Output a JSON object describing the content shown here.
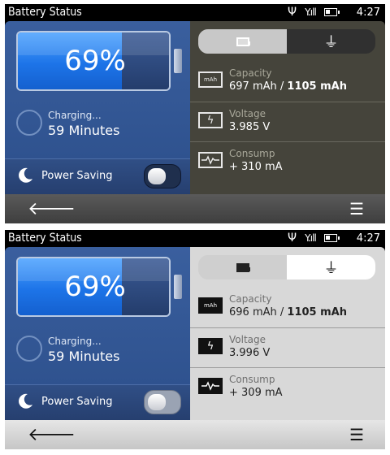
{
  "screens": [
    {
      "status": {
        "title": "Battery Status",
        "time": "4:27"
      },
      "battery": {
        "percent": "69%",
        "level": 0.69
      },
      "charging": {
        "label": "Charging...",
        "time": "59 Minutes"
      },
      "power_saving": {
        "label": "Power Saving",
        "enabled": false
      },
      "info": {
        "capacity": {
          "icon": "mAh",
          "label": "Capacity",
          "value_current": "697 mAh /",
          "value_total": "1105 mAh"
        },
        "voltage": {
          "label": "Voltage",
          "value": "3.985 V"
        },
        "consump": {
          "label": "Consump",
          "value": "+ 310 mA"
        }
      }
    },
    {
      "status": {
        "title": "Battery Status",
        "time": "4:27"
      },
      "battery": {
        "percent": "69%",
        "level": 0.69
      },
      "charging": {
        "label": "Charging...",
        "time": "59 Minutes"
      },
      "power_saving": {
        "label": "Power Saving",
        "enabled": false
      },
      "info": {
        "capacity": {
          "icon": "mAh",
          "label": "Capacity",
          "value_current": "696 mAh /",
          "value_total": "1105 mAh"
        },
        "voltage": {
          "label": "Voltage",
          "value": "3.996 V"
        },
        "consump": {
          "label": "Consump",
          "value": "+ 309 mA"
        }
      }
    }
  ],
  "colors": {
    "battery_fill": "#1d74e8",
    "left_panel": "#2c4f8b",
    "dark_panel": "#45443b",
    "light_panel": "#d8d8d8"
  }
}
